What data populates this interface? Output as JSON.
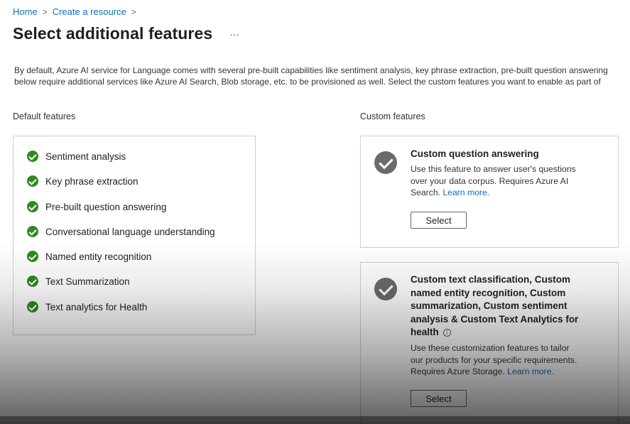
{
  "breadcrumb": {
    "home": "Home",
    "create_resource": "Create a resource",
    "separator": ">"
  },
  "page": {
    "title": "Select additional features",
    "more": "···"
  },
  "description": {
    "line1": "By default, Azure AI service for Language comes with several pre-built capabilities like sentiment analysis, key phrase extraction, pre-built question answering",
    "line2": "below require additional services like Azure AI Search, Blob storage, etc. to be provisioned as well. Select the custom features you want to enable as part of"
  },
  "default_features": {
    "label": "Default features",
    "items": [
      "Sentiment analysis",
      "Key phrase extraction",
      "Pre-built question answering",
      "Conversational language understanding",
      "Named entity recognition",
      "Text Summarization",
      "Text analytics for Health"
    ]
  },
  "custom_features": {
    "label": "Custom features",
    "cards": [
      {
        "title": "Custom question answering",
        "desc_lines": [
          "Use this feature to answer user's questions",
          "over your data corpus. Requires Azure AI",
          "Search."
        ],
        "learn_more": "Learn more.",
        "button": "Select"
      },
      {
        "title_lines": [
          "Custom text classification, Custom",
          "named entity recognition, Custom",
          "summarization, Custom sentiment",
          "analysis & Custom Text Analytics for",
          "health"
        ],
        "desc_lines": [
          "Use these customization features to tailor",
          "our products for your specific requirements.",
          "Requires Azure Storage."
        ],
        "learn_more": "Learn more.",
        "button": "Select"
      }
    ]
  },
  "colors": {
    "link": "#0f6cbd",
    "check_green": "#2e8b1f",
    "check_gray": "#6b6b6b"
  }
}
